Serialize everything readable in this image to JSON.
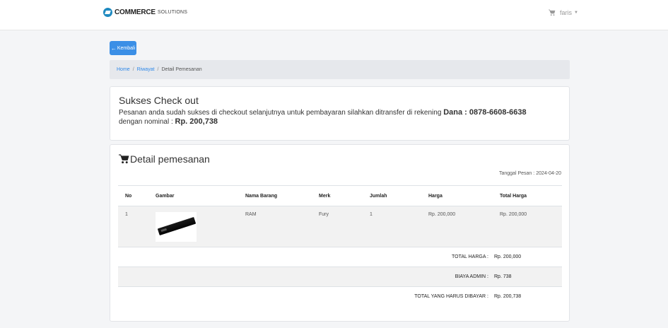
{
  "header": {
    "brand_strong": "COMMERCE",
    "brand_light": "SOLUTIONS",
    "user": "faris",
    "caret": "▼"
  },
  "back_button": {
    "label": "Kembali",
    "icon": "←"
  },
  "breadcrumb": {
    "home": "Home",
    "riwayat": "Riwayat",
    "current": "Detail Pemesanan",
    "sep": "/"
  },
  "success": {
    "title": "Sukses Check out",
    "text_prefix": "Pesanan anda sudah sukses di checkout selanjutnya untuk pembayaran silahkan ditransfer di rekening",
    "account_label": "Dana : 0878-6608-6638",
    "text_mid": "dengan nominal :",
    "amount": "Rp. 200,738"
  },
  "detail": {
    "title": "Detail pemesanan",
    "date_label": "Tanggal Pesan :",
    "date_value": "2024-04-20",
    "columns": [
      "No",
      "Gambar",
      "Nama Barang",
      "Merk",
      "Jumlah",
      "Harga",
      "Total Harga"
    ],
    "rows": [
      {
        "no": "1",
        "image": "ram-image",
        "name": "RAM",
        "brand": "Fury",
        "qty": "1",
        "price": "Rp. 200,000",
        "total": "Rp. 200,000"
      }
    ],
    "summary": [
      {
        "label": "TOTAL HARGA :",
        "value": "Rp. 200,000"
      },
      {
        "label": "BIAYA ADMIN :",
        "value": "Rp. 738"
      },
      {
        "label": "TOTAL YANG HARUS DIBAYAR :",
        "value": "Rp. 200,738"
      }
    ]
  },
  "colors": {
    "primary": "#3b8fe6",
    "link": "#2f88e8",
    "brand_icon": "#1f8ac0",
    "breadcrumb_bg": "#e6e8ec",
    "page_bg": "#f4f5f7"
  },
  "icons": [
    "brand-logo-icon",
    "cart-icon",
    "arrow-left-icon",
    "shopping-cart-icon"
  ]
}
